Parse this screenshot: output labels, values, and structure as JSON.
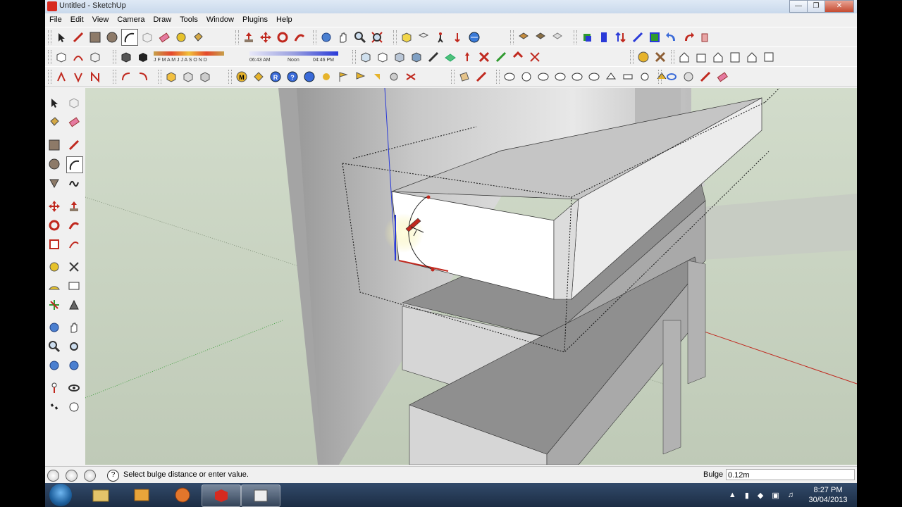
{
  "window": {
    "title": "Untitled - SketchUp",
    "controls": [
      "minimize",
      "maximize",
      "close"
    ]
  },
  "menu": [
    "File",
    "Edit",
    "View",
    "Camera",
    "Draw",
    "Tools",
    "Window",
    "Plugins",
    "Help"
  ],
  "shadow_settings": {
    "months": "J F M A M J J A S O N D",
    "time_start": "06:43 AM",
    "time_mid": "Noon",
    "time_end": "04:46 PM"
  },
  "status": {
    "message": "Select bulge distance or enter value.",
    "vcb_label": "Bulge",
    "vcb_value": "0.12m"
  },
  "taskbar": {
    "apps": [
      "explorer-icon",
      "outlook-icon",
      "firefox-icon",
      "sketchup-icon",
      "window-icon"
    ],
    "time": "8:27 PM",
    "date": "30/04/2013"
  },
  "colors": {
    "sky": "#d4e0cf",
    "ground": "#c6cfbe",
    "axis_red": "#c0281e",
    "axis_blue": "#2a3ad8",
    "axis_green": "#2f9a2f"
  }
}
